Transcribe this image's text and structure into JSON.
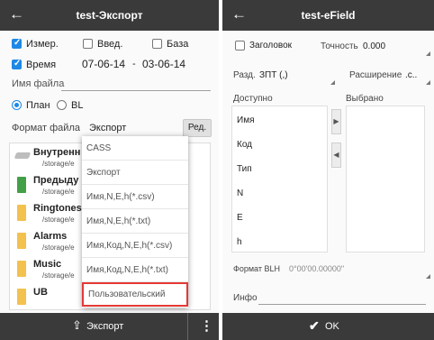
{
  "left": {
    "title": "test-Экспорт",
    "back_icon": "←",
    "measure_label": "Измер.",
    "input_label": "Введ.",
    "base_label": "База",
    "time_label": "Время",
    "date_from": "07-06-14",
    "date_sep": "-",
    "date_to": "03-06-14",
    "filename_label": "Имя файла",
    "plan_label": "План",
    "bl_label": "BL",
    "format_label": "Формат файла",
    "format_value": "Экспорт",
    "edit_button": "Ред.",
    "files": [
      {
        "name": "Внутренн",
        "path": "/storage/e",
        "icon": "drive-icon"
      },
      {
        "name": "Предыду",
        "path": "/storage/e",
        "icon": "folder-up-icon"
      },
      {
        "name": "Ringtones",
        "path": "/storage/e",
        "icon": "folder-icon"
      },
      {
        "name": "Alarms",
        "path": "/storage/e",
        "icon": "folder-icon"
      },
      {
        "name": "Music",
        "path": "/storage/e",
        "icon": "folder-icon"
      },
      {
        "name": "UB",
        "path": "",
        "icon": "folder-icon"
      }
    ],
    "dropdown_items": [
      "CASS",
      "Экспорт",
      "Имя,N,E,h(*.csv)",
      "Имя,N,E,h(*.txt)",
      "Имя,Код,N,E,h(*.csv)",
      "Имя,Код,N,E,h(*.txt)",
      "Пользовательский"
    ],
    "export_button": "Экспорт",
    "more_icon": "⋮"
  },
  "right": {
    "title": "test-eField",
    "back_icon": "←",
    "header_label": "Заголовок",
    "precision_label": "Точность",
    "precision_value": "0.000",
    "separator_label": "Разд.",
    "separator_value": "ЗПТ (,)",
    "extension_label": "Расширение",
    "extension_value": ".c..",
    "available_label": "Доступно",
    "selected_label": "Выбрано",
    "available_items": [
      "Имя",
      "Код",
      "Тип",
      "N",
      "E",
      "h"
    ],
    "blh_label": "Формат BLH",
    "blh_value": "0°00'00.00000\"",
    "info_label": "Инфо",
    "ok_button": "OK"
  },
  "colors": {
    "accent": "#1e88e5",
    "bar": "#3a3a3a",
    "highlight": "#e53935"
  }
}
